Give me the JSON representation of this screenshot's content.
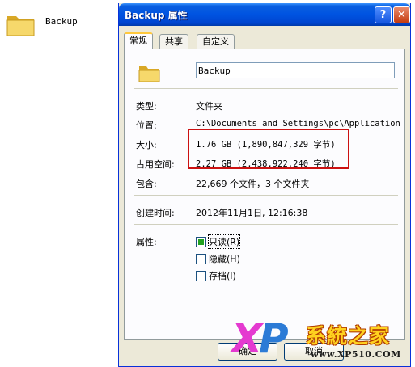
{
  "desktop": {
    "folder_label": "Backup",
    "folder_icon": "folder-icon"
  },
  "window": {
    "title": "Backup 属性",
    "help_glyph": "?",
    "close_glyph": "✕"
  },
  "tabs": [
    {
      "label": "常规",
      "active": true
    },
    {
      "label": "共享",
      "active": false
    },
    {
      "label": "自定义",
      "active": false
    }
  ],
  "general": {
    "name_value": "Backup",
    "type_label": "类型:",
    "type_value": "文件夹",
    "location_label": "位置:",
    "location_value": "C:\\Documents and Settings\\pc\\Application",
    "size_label": "大小:",
    "size_value": "1.76 GB (1,890,847,329 字节)",
    "disk_label": "占用空间:",
    "disk_value": "2.27 GB (2,438,922,240 字节)",
    "contains_label": "包含:",
    "contains_value": "22,669 个文件，3 个文件夹",
    "created_label": "创建时间:",
    "created_value": "2012年11月1日, 12:16:38",
    "attributes_label": "属性:",
    "attributes": [
      {
        "label": "只读(R)",
        "checked": true
      },
      {
        "label": "隐藏(H)",
        "checked": false
      },
      {
        "label": "存档(I)",
        "checked": false
      }
    ]
  },
  "buttons": {
    "ok": "确定",
    "cancel": "取消"
  },
  "watermark": {
    "x": "X",
    "p": "P",
    "name": "系統之家",
    "url": "www.XP510.COM"
  },
  "colors": {
    "titlebar": "#0053e1",
    "highlight_box": "#cc1111",
    "tab_accent": "#ffc83c"
  }
}
